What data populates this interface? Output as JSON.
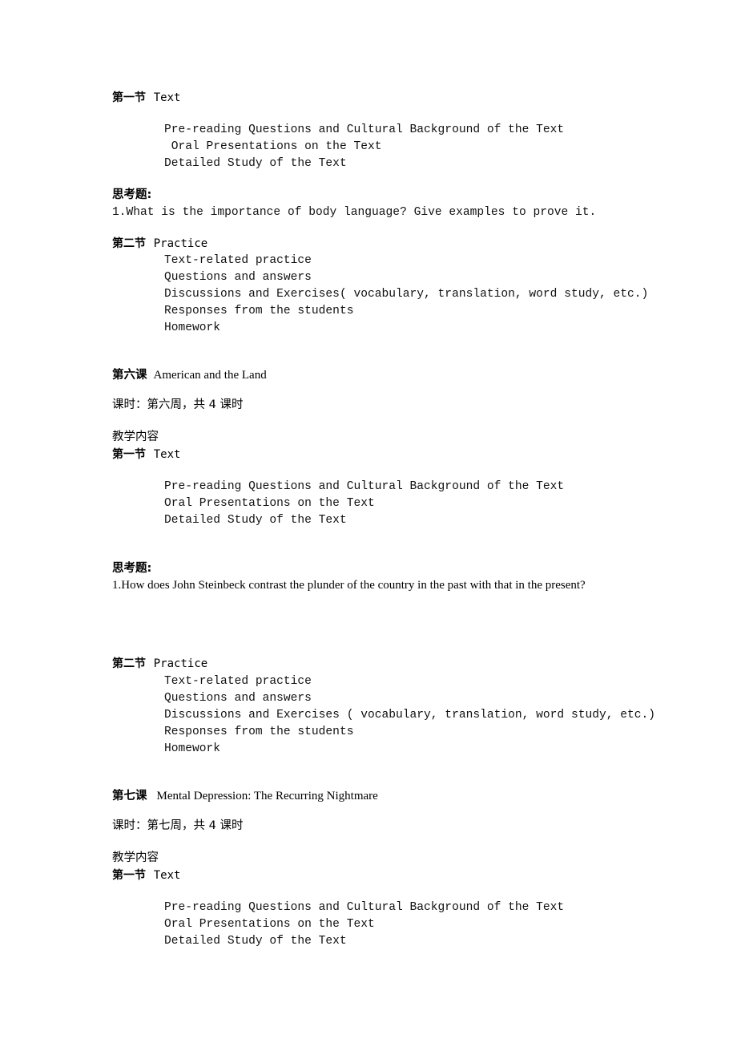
{
  "blocks": {
    "b1": {
      "section1": {
        "label": "第一节",
        "title": "Text"
      },
      "items1": [
        "Pre-reading Questions and Cultural Background of the Text",
        " Oral Presentations on the Text",
        "Detailed Study of the Text"
      ],
      "question_label": "思考题:",
      "question": "1.What is the importance of body language? Give examples to prove it.",
      "section2": {
        "label": "第二节",
        "title": "Practice"
      },
      "items2": [
        "Text-related practice",
        "Questions and answers",
        "Discussions and Exercises( vocabulary, translation, word study, etc.)",
        "Responses from the students",
        "Homework"
      ]
    },
    "lesson6": {
      "label": "第六课",
      "title": "American and the Land",
      "hours": "课时：第六周，共 4 课时",
      "content_label": "教学内容",
      "section1": {
        "label": "第一节",
        "title": "Text"
      },
      "items1": [
        "Pre-reading Questions and Cultural Background of the Text",
        "Oral Presentations on the Text",
        "Detailed Study of the Text"
      ],
      "question_label": "思考题:",
      "question": "1.How does John Steinbeck contrast the plunder of the country in the past with that in the present?",
      "section2": {
        "label": "第二节",
        "title": "Practice"
      },
      "items2": [
        "Text-related practice",
        "Questions and answers",
        "Discussions and Exercises ( vocabulary, translation, word study, etc.)",
        "Responses from the students",
        "Homework"
      ]
    },
    "lesson7": {
      "label": "第七课",
      "title": "Mental Depression: The Recurring Nightmare",
      "hours": "课时：第七周，共 4 课时",
      "content_label": "教学内容",
      "section1": {
        "label": "第一节",
        "title": "Text"
      },
      "items1": [
        "Pre-reading Questions and Cultural Background of the Text",
        "Oral Presentations on the Text",
        "Detailed Study of the Text"
      ]
    }
  }
}
